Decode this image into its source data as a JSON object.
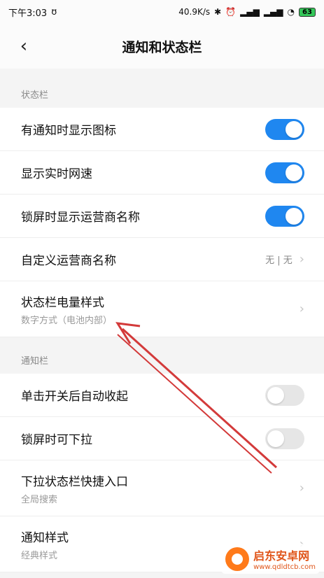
{
  "status_bar": {
    "time": "下午3:03",
    "speed": "40.9K/s",
    "battery": "63",
    "colors": {
      "battery": "#34c759"
    }
  },
  "header": {
    "title": "通知和状态栏"
  },
  "sections": [
    {
      "header": "状态栏",
      "rows": [
        {
          "label": "有通知时显示图标",
          "control": "toggle",
          "state": "on"
        },
        {
          "label": "显示实时网速",
          "control": "toggle",
          "state": "on"
        },
        {
          "label": "锁屏时显示运营商名称",
          "control": "toggle",
          "state": "on"
        },
        {
          "label": "自定义运营商名称",
          "control": "chevron",
          "value": "无 | 无"
        },
        {
          "label": "状态栏电量样式",
          "sublabel": "数字方式（电池内部）",
          "control": "chevron"
        }
      ]
    },
    {
      "header": "通知栏",
      "rows": [
        {
          "label": "单击开关后自动收起",
          "control": "toggle",
          "state": "off"
        },
        {
          "label": "锁屏时可下拉",
          "control": "toggle",
          "state": "off"
        },
        {
          "label": "下拉状态栏快捷入口",
          "sublabel": "全局搜索",
          "control": "chevron"
        },
        {
          "label": "通知样式",
          "sublabel": "经典样式",
          "control": "chevron"
        }
      ]
    }
  ],
  "watermark": {
    "name": "启东安卓网",
    "url": "www.qdldtcb.com"
  },
  "colors": {
    "accent": "#1f87f0",
    "arrow": "#d33a3a"
  }
}
